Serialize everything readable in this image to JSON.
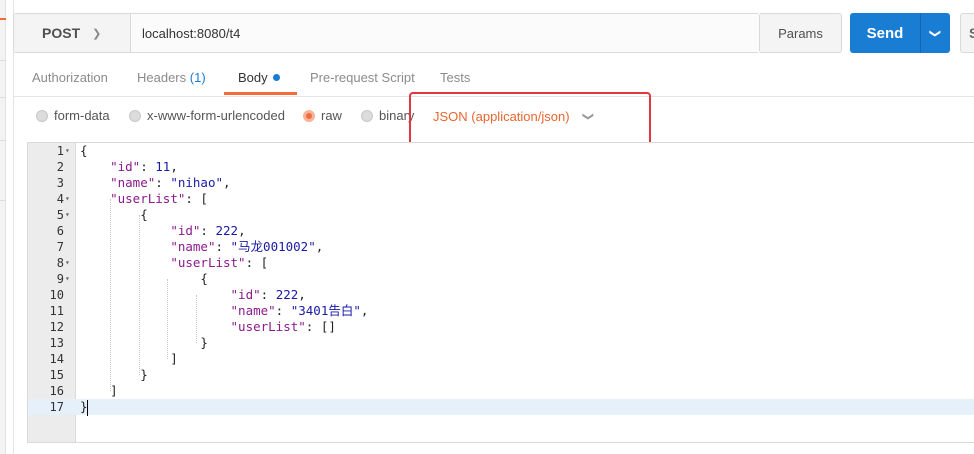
{
  "request": {
    "method": "POST",
    "url": "localhost:8080/t4",
    "params_label": "Params",
    "send_label": "Send",
    "save_label": "S"
  },
  "tabs": [
    {
      "label": "Authorization",
      "count": ""
    },
    {
      "label": "Headers",
      "count": "(1)"
    },
    {
      "label": "Body",
      "count": ""
    },
    {
      "label": "Pre-request Script",
      "count": ""
    },
    {
      "label": "Tests",
      "count": ""
    }
  ],
  "active_tab": "Body",
  "body_modes": [
    {
      "label": "form-data",
      "checked": false
    },
    {
      "label": "x-www-form-urlencoded",
      "checked": false
    },
    {
      "label": "raw",
      "checked": true
    },
    {
      "label": "binary",
      "checked": false
    }
  ],
  "content_type": "JSON (application/json)",
  "editor": {
    "line_numbers": [
      "1",
      "2",
      "3",
      "4",
      "5",
      "6",
      "7",
      "8",
      "9",
      "10",
      "11",
      "12",
      "13",
      "14",
      "15",
      "16",
      "17"
    ],
    "fold_markers": [
      "▾",
      "",
      "",
      "▾",
      "▾",
      "",
      "",
      "▾",
      "▾",
      "",
      "",
      "",
      "",
      "",
      "",
      "",
      ""
    ],
    "active_line": 17
  },
  "colors": {
    "accent": "#f26b3a",
    "send": "#1a7dd4",
    "highlight": "#e0383e"
  }
}
